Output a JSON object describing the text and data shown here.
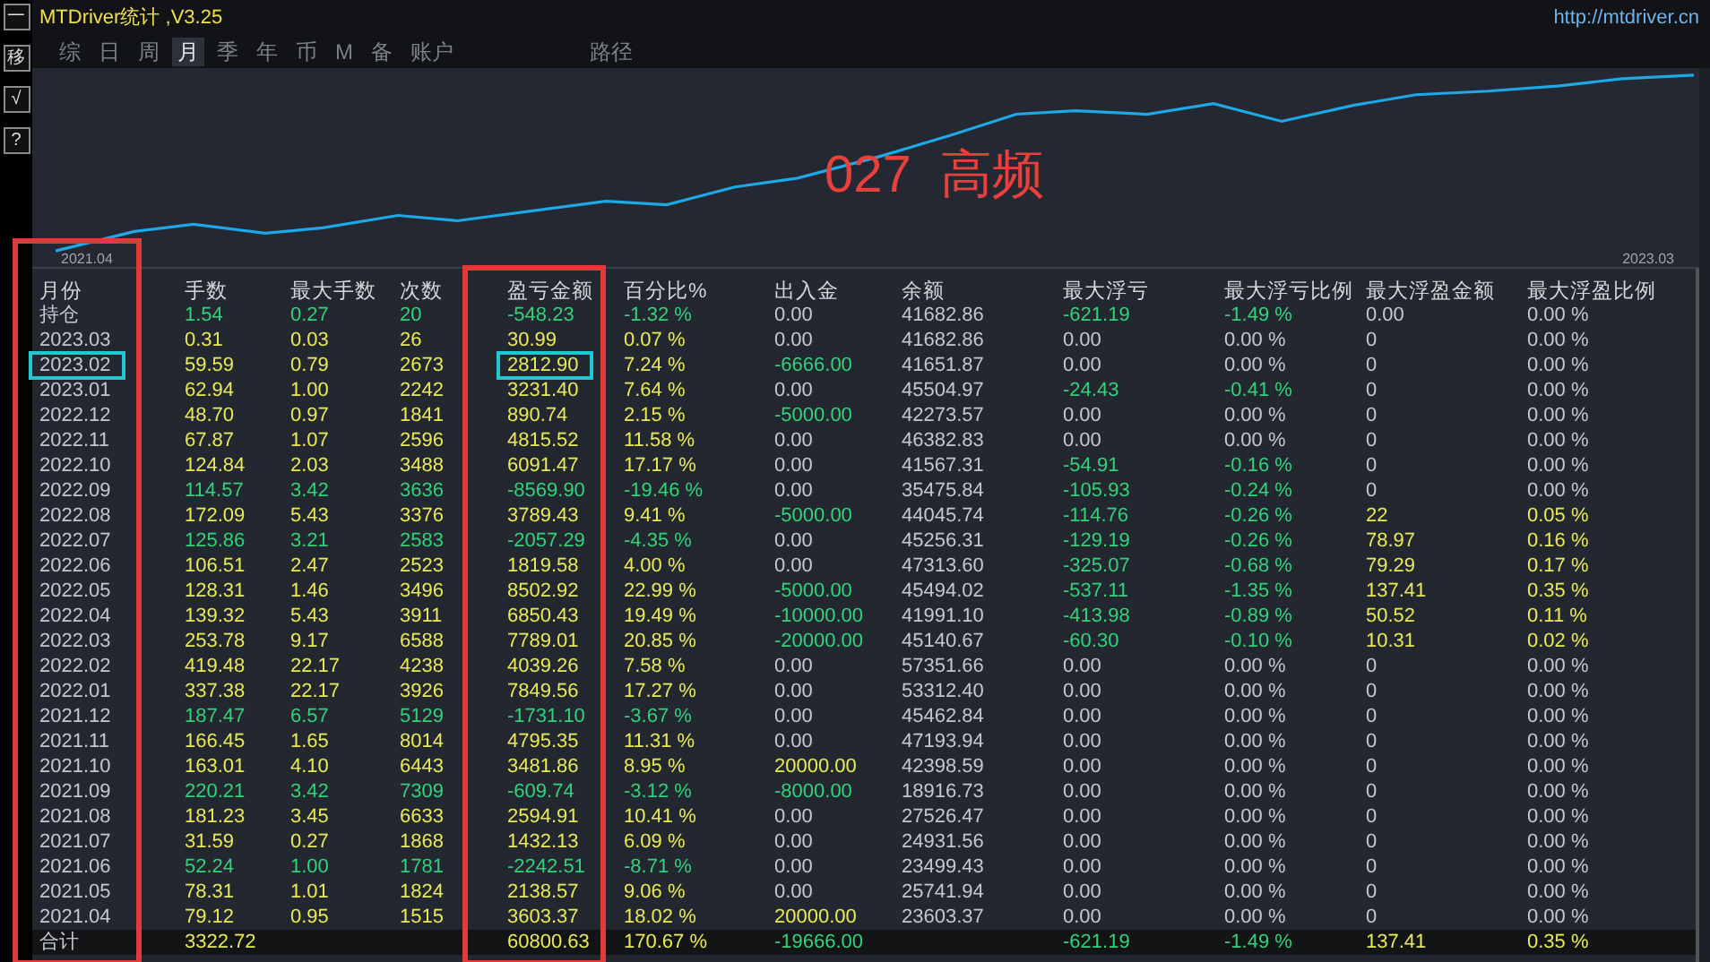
{
  "toolbar": [
    "一",
    "移",
    "√",
    "?"
  ],
  "window": {
    "title": "MTDriver统计 ,V3.25",
    "link": "http://mtdriver.cn"
  },
  "tabs": [
    {
      "label": "综",
      "selected": false
    },
    {
      "label": "日",
      "selected": false
    },
    {
      "label": "周",
      "selected": false
    },
    {
      "label": "月",
      "selected": true
    },
    {
      "label": "季",
      "selected": false
    },
    {
      "label": "年",
      "selected": false
    },
    {
      "label": "币",
      "selected": false
    },
    {
      "label": "M",
      "selected": false
    },
    {
      "label": "备",
      "selected": false
    },
    {
      "label": "账户",
      "selected": false
    }
  ],
  "path_tab": {
    "label": "路径",
    "selected": false
  },
  "chart": {
    "overlay_text": "027  高频",
    "x_start": "2021.04",
    "x_end": "2023.03"
  },
  "table": {
    "columns": [
      "月份",
      "手数",
      "最大手数",
      "次数",
      "盈亏金额",
      "百分比%",
      "出入金",
      "余额",
      "最大浮亏",
      "最大浮亏比例",
      "最大浮盈金额",
      "最大浮盈比例"
    ],
    "rows": [
      {
        "marked": false,
        "cells": [
          {
            "text": "持仓"
          },
          {
            "text": "1.54",
            "color": "#35d07a"
          },
          {
            "text": "0.27",
            "color": "#35d07a"
          },
          {
            "text": "20",
            "color": "#35d07a"
          },
          {
            "text": "-548.23",
            "color": "#35d07a"
          },
          {
            "text": "-1.32 %",
            "color": "#35d07a"
          },
          {
            "text": "0.00",
            "color": "#c4c8cc"
          },
          {
            "text": "41682.86",
            "color": "#c4c8cc"
          },
          {
            "text": "-621.19",
            "color": "#35d07a"
          },
          {
            "text": "-1.49 %",
            "color": "#35d07a"
          },
          {
            "text": "0.00",
            "color": "#c4c8cc"
          },
          {
            "text": "0.00 %",
            "color": "#c4c8cc"
          }
        ]
      },
      {
        "marked": false,
        "cells": [
          {
            "text": "2023.03"
          },
          {
            "text": "0.31",
            "color": "#e8e85a"
          },
          {
            "text": "0.03",
            "color": "#e8e85a"
          },
          {
            "text": "26",
            "color": "#e8e85a"
          },
          {
            "text": "30.99",
            "color": "#e8e85a"
          },
          {
            "text": "0.07 %",
            "color": "#e8e85a"
          },
          {
            "text": "0.00",
            "color": "#c4c8cc"
          },
          {
            "text": "41682.86",
            "color": "#c4c8cc"
          },
          {
            "text": "0.00",
            "color": "#c4c8cc"
          },
          {
            "text": "0.00 %",
            "color": "#c4c8cc"
          },
          {
            "text": "0",
            "color": "#c4c8cc"
          },
          {
            "text": "0.00 %",
            "color": "#c4c8cc"
          }
        ]
      },
      {
        "marked": true,
        "cells": [
          {
            "text": "2023.02"
          },
          {
            "text": "59.59",
            "color": "#e8e85a"
          },
          {
            "text": "0.79",
            "color": "#e8e85a"
          },
          {
            "text": "2673",
            "color": "#e8e85a"
          },
          {
            "text": "2812.90",
            "color": "#e8e85a"
          },
          {
            "text": "7.24 %",
            "color": "#e8e85a"
          },
          {
            "text": "-6666.00",
            "color": "#35d07a"
          },
          {
            "text": "41651.87",
            "color": "#c4c8cc"
          },
          {
            "text": "0.00",
            "color": "#c4c8cc"
          },
          {
            "text": "0.00 %",
            "color": "#c4c8cc"
          },
          {
            "text": "0",
            "color": "#c4c8cc"
          },
          {
            "text": "0.00 %",
            "color": "#c4c8cc"
          }
        ]
      },
      {
        "marked": false,
        "cells": [
          {
            "text": "2023.01"
          },
          {
            "text": "62.94",
            "color": "#e8e85a"
          },
          {
            "text": "1.00",
            "color": "#e8e85a"
          },
          {
            "text": "2242",
            "color": "#e8e85a"
          },
          {
            "text": "3231.40",
            "color": "#e8e85a"
          },
          {
            "text": "7.64 %",
            "color": "#e8e85a"
          },
          {
            "text": "0.00",
            "color": "#c4c8cc"
          },
          {
            "text": "45504.97",
            "color": "#c4c8cc"
          },
          {
            "text": "-24.43",
            "color": "#35d07a"
          },
          {
            "text": "-0.41 %",
            "color": "#35d07a"
          },
          {
            "text": "0",
            "color": "#c4c8cc"
          },
          {
            "text": "0.00 %",
            "color": "#c4c8cc"
          }
        ]
      },
      {
        "marked": false,
        "cells": [
          {
            "text": "2022.12"
          },
          {
            "text": "48.70",
            "color": "#e8e85a"
          },
          {
            "text": "0.97",
            "color": "#e8e85a"
          },
          {
            "text": "1841",
            "color": "#e8e85a"
          },
          {
            "text": "890.74",
            "color": "#e8e85a"
          },
          {
            "text": "2.15 %",
            "color": "#e8e85a"
          },
          {
            "text": "-5000.00",
            "color": "#35d07a"
          },
          {
            "text": "42273.57",
            "color": "#c4c8cc"
          },
          {
            "text": "0.00",
            "color": "#c4c8cc"
          },
          {
            "text": "0.00 %",
            "color": "#c4c8cc"
          },
          {
            "text": "0",
            "color": "#c4c8cc"
          },
          {
            "text": "0.00 %",
            "color": "#c4c8cc"
          }
        ]
      },
      {
        "marked": false,
        "cells": [
          {
            "text": "2022.11"
          },
          {
            "text": "67.87",
            "color": "#e8e85a"
          },
          {
            "text": "1.07",
            "color": "#e8e85a"
          },
          {
            "text": "2596",
            "color": "#e8e85a"
          },
          {
            "text": "4815.52",
            "color": "#e8e85a"
          },
          {
            "text": "11.58 %",
            "color": "#e8e85a"
          },
          {
            "text": "0.00",
            "color": "#c4c8cc"
          },
          {
            "text": "46382.83",
            "color": "#c4c8cc"
          },
          {
            "text": "0.00",
            "color": "#c4c8cc"
          },
          {
            "text": "0.00 %",
            "color": "#c4c8cc"
          },
          {
            "text": "0",
            "color": "#c4c8cc"
          },
          {
            "text": "0.00 %",
            "color": "#c4c8cc"
          }
        ]
      },
      {
        "marked": false,
        "cells": [
          {
            "text": "2022.10"
          },
          {
            "text": "124.84",
            "color": "#e8e85a"
          },
          {
            "text": "2.03",
            "color": "#e8e85a"
          },
          {
            "text": "3488",
            "color": "#e8e85a"
          },
          {
            "text": "6091.47",
            "color": "#e8e85a"
          },
          {
            "text": "17.17 %",
            "color": "#e8e85a"
          },
          {
            "text": "0.00",
            "color": "#c4c8cc"
          },
          {
            "text": "41567.31",
            "color": "#c4c8cc"
          },
          {
            "text": "-54.91",
            "color": "#35d07a"
          },
          {
            "text": "-0.16 %",
            "color": "#35d07a"
          },
          {
            "text": "0",
            "color": "#c4c8cc"
          },
          {
            "text": "0.00 %",
            "color": "#c4c8cc"
          }
        ]
      },
      {
        "marked": false,
        "cells": [
          {
            "text": "2022.09"
          },
          {
            "text": "114.57",
            "color": "#35d07a"
          },
          {
            "text": "3.42",
            "color": "#35d07a"
          },
          {
            "text": "3636",
            "color": "#35d07a"
          },
          {
            "text": "-8569.90",
            "color": "#35d07a"
          },
          {
            "text": "-19.46 %",
            "color": "#35d07a"
          },
          {
            "text": "0.00",
            "color": "#c4c8cc"
          },
          {
            "text": "35475.84",
            "color": "#c4c8cc"
          },
          {
            "text": "-105.93",
            "color": "#35d07a"
          },
          {
            "text": "-0.24 %",
            "color": "#35d07a"
          },
          {
            "text": "0",
            "color": "#c4c8cc"
          },
          {
            "text": "0.00 %",
            "color": "#c4c8cc"
          }
        ]
      },
      {
        "marked": false,
        "cells": [
          {
            "text": "2022.08"
          },
          {
            "text": "172.09",
            "color": "#e8e85a"
          },
          {
            "text": "5.43",
            "color": "#e8e85a"
          },
          {
            "text": "3376",
            "color": "#e8e85a"
          },
          {
            "text": "3789.43",
            "color": "#e8e85a"
          },
          {
            "text": "9.41 %",
            "color": "#e8e85a"
          },
          {
            "text": "-5000.00",
            "color": "#35d07a"
          },
          {
            "text": "44045.74",
            "color": "#c4c8cc"
          },
          {
            "text": "-114.76",
            "color": "#35d07a"
          },
          {
            "text": "-0.26 %",
            "color": "#35d07a"
          },
          {
            "text": "22",
            "color": "#e8e85a"
          },
          {
            "text": "0.05 %",
            "color": "#e8e85a"
          }
        ]
      },
      {
        "marked": false,
        "cells": [
          {
            "text": "2022.07"
          },
          {
            "text": "125.86",
            "color": "#35d07a"
          },
          {
            "text": "3.21",
            "color": "#35d07a"
          },
          {
            "text": "2583",
            "color": "#35d07a"
          },
          {
            "text": "-2057.29",
            "color": "#35d07a"
          },
          {
            "text": "-4.35 %",
            "color": "#35d07a"
          },
          {
            "text": "0.00",
            "color": "#c4c8cc"
          },
          {
            "text": "45256.31",
            "color": "#c4c8cc"
          },
          {
            "text": "-129.19",
            "color": "#35d07a"
          },
          {
            "text": "-0.26 %",
            "color": "#35d07a"
          },
          {
            "text": "78.97",
            "color": "#e8e85a"
          },
          {
            "text": "0.16 %",
            "color": "#e8e85a"
          }
        ]
      },
      {
        "marked": false,
        "cells": [
          {
            "text": "2022.06"
          },
          {
            "text": "106.51",
            "color": "#e8e85a"
          },
          {
            "text": "2.47",
            "color": "#e8e85a"
          },
          {
            "text": "2523",
            "color": "#e8e85a"
          },
          {
            "text": "1819.58",
            "color": "#e8e85a"
          },
          {
            "text": "4.00 %",
            "color": "#e8e85a"
          },
          {
            "text": "0.00",
            "color": "#c4c8cc"
          },
          {
            "text": "47313.60",
            "color": "#c4c8cc"
          },
          {
            "text": "-325.07",
            "color": "#35d07a"
          },
          {
            "text": "-0.68 %",
            "color": "#35d07a"
          },
          {
            "text": "79.29",
            "color": "#e8e85a"
          },
          {
            "text": "0.17 %",
            "color": "#e8e85a"
          }
        ]
      },
      {
        "marked": false,
        "cells": [
          {
            "text": "2022.05"
          },
          {
            "text": "128.31",
            "color": "#e8e85a"
          },
          {
            "text": "1.46",
            "color": "#e8e85a"
          },
          {
            "text": "3496",
            "color": "#e8e85a"
          },
          {
            "text": "8502.92",
            "color": "#e8e85a"
          },
          {
            "text": "22.99 %",
            "color": "#e8e85a"
          },
          {
            "text": "-5000.00",
            "color": "#35d07a"
          },
          {
            "text": "45494.02",
            "color": "#c4c8cc"
          },
          {
            "text": "-537.11",
            "color": "#35d07a"
          },
          {
            "text": "-1.35 %",
            "color": "#35d07a"
          },
          {
            "text": "137.41",
            "color": "#e8e85a"
          },
          {
            "text": "0.35 %",
            "color": "#e8e85a"
          }
        ]
      },
      {
        "marked": false,
        "cells": [
          {
            "text": "2022.04"
          },
          {
            "text": "139.32",
            "color": "#e8e85a"
          },
          {
            "text": "5.43",
            "color": "#e8e85a"
          },
          {
            "text": "3911",
            "color": "#e8e85a"
          },
          {
            "text": "6850.43",
            "color": "#e8e85a"
          },
          {
            "text": "19.49 %",
            "color": "#e8e85a"
          },
          {
            "text": "-10000.00",
            "color": "#35d07a"
          },
          {
            "text": "41991.10",
            "color": "#c4c8cc"
          },
          {
            "text": "-413.98",
            "color": "#35d07a"
          },
          {
            "text": "-0.89 %",
            "color": "#35d07a"
          },
          {
            "text": "50.52",
            "color": "#e8e85a"
          },
          {
            "text": "0.11 %",
            "color": "#e8e85a"
          }
        ]
      },
      {
        "marked": false,
        "cells": [
          {
            "text": "2022.03"
          },
          {
            "text": "253.78",
            "color": "#e8e85a"
          },
          {
            "text": "9.17",
            "color": "#e8e85a"
          },
          {
            "text": "6588",
            "color": "#e8e85a"
          },
          {
            "text": "7789.01",
            "color": "#e8e85a"
          },
          {
            "text": "20.85 %",
            "color": "#e8e85a"
          },
          {
            "text": "-20000.00",
            "color": "#35d07a"
          },
          {
            "text": "45140.67",
            "color": "#c4c8cc"
          },
          {
            "text": "-60.30",
            "color": "#35d07a"
          },
          {
            "text": "-0.10 %",
            "color": "#35d07a"
          },
          {
            "text": "10.31",
            "color": "#e8e85a"
          },
          {
            "text": "0.02 %",
            "color": "#e8e85a"
          }
        ]
      },
      {
        "marked": false,
        "cells": [
          {
            "text": "2022.02"
          },
          {
            "text": "419.48",
            "color": "#e8e85a"
          },
          {
            "text": "22.17",
            "color": "#e8e85a"
          },
          {
            "text": "4238",
            "color": "#e8e85a"
          },
          {
            "text": "4039.26",
            "color": "#e8e85a"
          },
          {
            "text": "7.58 %",
            "color": "#e8e85a"
          },
          {
            "text": "0.00",
            "color": "#c4c8cc"
          },
          {
            "text": "57351.66",
            "color": "#c4c8cc"
          },
          {
            "text": "0.00",
            "color": "#c4c8cc"
          },
          {
            "text": "0.00 %",
            "color": "#c4c8cc"
          },
          {
            "text": "0",
            "color": "#c4c8cc"
          },
          {
            "text": "0.00 %",
            "color": "#c4c8cc"
          }
        ]
      },
      {
        "marked": false,
        "cells": [
          {
            "text": "2022.01"
          },
          {
            "text": "337.38",
            "color": "#e8e85a"
          },
          {
            "text": "22.17",
            "color": "#e8e85a"
          },
          {
            "text": "3926",
            "color": "#e8e85a"
          },
          {
            "text": "7849.56",
            "color": "#e8e85a"
          },
          {
            "text": "17.27 %",
            "color": "#e8e85a"
          },
          {
            "text": "0.00",
            "color": "#c4c8cc"
          },
          {
            "text": "53312.40",
            "color": "#c4c8cc"
          },
          {
            "text": "0.00",
            "color": "#c4c8cc"
          },
          {
            "text": "0.00 %",
            "color": "#c4c8cc"
          },
          {
            "text": "0",
            "color": "#c4c8cc"
          },
          {
            "text": "0.00 %",
            "color": "#c4c8cc"
          }
        ]
      },
      {
        "marked": false,
        "cells": [
          {
            "text": "2021.12"
          },
          {
            "text": "187.47",
            "color": "#35d07a"
          },
          {
            "text": "6.57",
            "color": "#35d07a"
          },
          {
            "text": "5129",
            "color": "#35d07a"
          },
          {
            "text": "-1731.10",
            "color": "#35d07a"
          },
          {
            "text": "-3.67 %",
            "color": "#35d07a"
          },
          {
            "text": "0.00",
            "color": "#c4c8cc"
          },
          {
            "text": "45462.84",
            "color": "#c4c8cc"
          },
          {
            "text": "0.00",
            "color": "#c4c8cc"
          },
          {
            "text": "0.00 %",
            "color": "#c4c8cc"
          },
          {
            "text": "0",
            "color": "#c4c8cc"
          },
          {
            "text": "0.00 %",
            "color": "#c4c8cc"
          }
        ]
      },
      {
        "marked": false,
        "cells": [
          {
            "text": "2021.11"
          },
          {
            "text": "166.45",
            "color": "#e8e85a"
          },
          {
            "text": "1.65",
            "color": "#e8e85a"
          },
          {
            "text": "8014",
            "color": "#e8e85a"
          },
          {
            "text": "4795.35",
            "color": "#e8e85a"
          },
          {
            "text": "11.31 %",
            "color": "#e8e85a"
          },
          {
            "text": "0.00",
            "color": "#c4c8cc"
          },
          {
            "text": "47193.94",
            "color": "#c4c8cc"
          },
          {
            "text": "0.00",
            "color": "#c4c8cc"
          },
          {
            "text": "0.00 %",
            "color": "#c4c8cc"
          },
          {
            "text": "0",
            "color": "#c4c8cc"
          },
          {
            "text": "0.00 %",
            "color": "#c4c8cc"
          }
        ]
      },
      {
        "marked": false,
        "cells": [
          {
            "text": "2021.10"
          },
          {
            "text": "163.01",
            "color": "#e8e85a"
          },
          {
            "text": "4.10",
            "color": "#e8e85a"
          },
          {
            "text": "6443",
            "color": "#e8e85a"
          },
          {
            "text": "3481.86",
            "color": "#e8e85a"
          },
          {
            "text": "8.95 %",
            "color": "#e8e85a"
          },
          {
            "text": "20000.00",
            "color": "#e8e85a"
          },
          {
            "text": "42398.59",
            "color": "#c4c8cc"
          },
          {
            "text": "0.00",
            "color": "#c4c8cc"
          },
          {
            "text": "0.00 %",
            "color": "#c4c8cc"
          },
          {
            "text": "0",
            "color": "#c4c8cc"
          },
          {
            "text": "0.00 %",
            "color": "#c4c8cc"
          }
        ]
      },
      {
        "marked": false,
        "cells": [
          {
            "text": "2021.09"
          },
          {
            "text": "220.21",
            "color": "#35d07a"
          },
          {
            "text": "3.42",
            "color": "#35d07a"
          },
          {
            "text": "7309",
            "color": "#35d07a"
          },
          {
            "text": "-609.74",
            "color": "#35d07a"
          },
          {
            "text": "-3.12 %",
            "color": "#35d07a"
          },
          {
            "text": "-8000.00",
            "color": "#35d07a"
          },
          {
            "text": "18916.73",
            "color": "#c4c8cc"
          },
          {
            "text": "0.00",
            "color": "#c4c8cc"
          },
          {
            "text": "0.00 %",
            "color": "#c4c8cc"
          },
          {
            "text": "0",
            "color": "#c4c8cc"
          },
          {
            "text": "0.00 %",
            "color": "#c4c8cc"
          }
        ]
      },
      {
        "marked": false,
        "cells": [
          {
            "text": "2021.08"
          },
          {
            "text": "181.23",
            "color": "#e8e85a"
          },
          {
            "text": "3.45",
            "color": "#e8e85a"
          },
          {
            "text": "6633",
            "color": "#e8e85a"
          },
          {
            "text": "2594.91",
            "color": "#e8e85a"
          },
          {
            "text": "10.41 %",
            "color": "#e8e85a"
          },
          {
            "text": "0.00",
            "color": "#c4c8cc"
          },
          {
            "text": "27526.47",
            "color": "#c4c8cc"
          },
          {
            "text": "0.00",
            "color": "#c4c8cc"
          },
          {
            "text": "0.00 %",
            "color": "#c4c8cc"
          },
          {
            "text": "0",
            "color": "#c4c8cc"
          },
          {
            "text": "0.00 %",
            "color": "#c4c8cc"
          }
        ]
      },
      {
        "marked": false,
        "cells": [
          {
            "text": "2021.07"
          },
          {
            "text": "31.59",
            "color": "#e8e85a"
          },
          {
            "text": "0.27",
            "color": "#e8e85a"
          },
          {
            "text": "1868",
            "color": "#e8e85a"
          },
          {
            "text": "1432.13",
            "color": "#e8e85a"
          },
          {
            "text": "6.09 %",
            "color": "#e8e85a"
          },
          {
            "text": "0.00",
            "color": "#c4c8cc"
          },
          {
            "text": "24931.56",
            "color": "#c4c8cc"
          },
          {
            "text": "0.00",
            "color": "#c4c8cc"
          },
          {
            "text": "0.00 %",
            "color": "#c4c8cc"
          },
          {
            "text": "0",
            "color": "#c4c8cc"
          },
          {
            "text": "0.00 %",
            "color": "#c4c8cc"
          }
        ]
      },
      {
        "marked": false,
        "cells": [
          {
            "text": "2021.06"
          },
          {
            "text": "52.24",
            "color": "#35d07a"
          },
          {
            "text": "1.00",
            "color": "#35d07a"
          },
          {
            "text": "1781",
            "color": "#35d07a"
          },
          {
            "text": "-2242.51",
            "color": "#35d07a"
          },
          {
            "text": "-8.71 %",
            "color": "#35d07a"
          },
          {
            "text": "0.00",
            "color": "#c4c8cc"
          },
          {
            "text": "23499.43",
            "color": "#c4c8cc"
          },
          {
            "text": "0.00",
            "color": "#c4c8cc"
          },
          {
            "text": "0.00 %",
            "color": "#c4c8cc"
          },
          {
            "text": "0",
            "color": "#c4c8cc"
          },
          {
            "text": "0.00 %",
            "color": "#c4c8cc"
          }
        ]
      },
      {
        "marked": false,
        "cells": [
          {
            "text": "2021.05"
          },
          {
            "text": "78.31",
            "color": "#e8e85a"
          },
          {
            "text": "1.01",
            "color": "#e8e85a"
          },
          {
            "text": "1824",
            "color": "#e8e85a"
          },
          {
            "text": "2138.57",
            "color": "#e8e85a"
          },
          {
            "text": "9.06 %",
            "color": "#e8e85a"
          },
          {
            "text": "0.00",
            "color": "#c4c8cc"
          },
          {
            "text": "25741.94",
            "color": "#c4c8cc"
          },
          {
            "text": "0.00",
            "color": "#c4c8cc"
          },
          {
            "text": "0.00 %",
            "color": "#c4c8cc"
          },
          {
            "text": "0",
            "color": "#c4c8cc"
          },
          {
            "text": "0.00 %",
            "color": "#c4c8cc"
          }
        ]
      },
      {
        "marked": false,
        "cells": [
          {
            "text": "2021.04"
          },
          {
            "text": "79.12",
            "color": "#e8e85a"
          },
          {
            "text": "0.95",
            "color": "#e8e85a"
          },
          {
            "text": "1515",
            "color": "#e8e85a"
          },
          {
            "text": "3603.37",
            "color": "#e8e85a"
          },
          {
            "text": "18.02 %",
            "color": "#e8e85a"
          },
          {
            "text": "20000.00",
            "color": "#e8e85a"
          },
          {
            "text": "23603.37",
            "color": "#c4c8cc"
          },
          {
            "text": "0.00",
            "color": "#c4c8cc"
          },
          {
            "text": "0.00 %",
            "color": "#c4c8cc"
          },
          {
            "text": "0",
            "color": "#c4c8cc"
          },
          {
            "text": "0.00 %",
            "color": "#c4c8cc"
          }
        ]
      }
    ],
    "total": {
      "cells": [
        {
          "text": "合计"
        },
        {
          "text": "3322.72",
          "color": "#e8e85a"
        },
        {
          "text": ""
        },
        {
          "text": ""
        },
        {
          "text": "60800.63",
          "color": "#e8e85a"
        },
        {
          "text": "170.67 %",
          "color": "#e8e85a"
        },
        {
          "text": "-19666.00",
          "color": "#35d07a"
        },
        {
          "text": ""
        },
        {
          "text": "-621.19",
          "color": "#35d07a"
        },
        {
          "text": "-1.49 %",
          "color": "#35d07a"
        },
        {
          "text": "137.41",
          "color": "#e8e85a"
        },
        {
          "text": "0.35 %",
          "color": "#e8e85a"
        }
      ]
    }
  }
}
